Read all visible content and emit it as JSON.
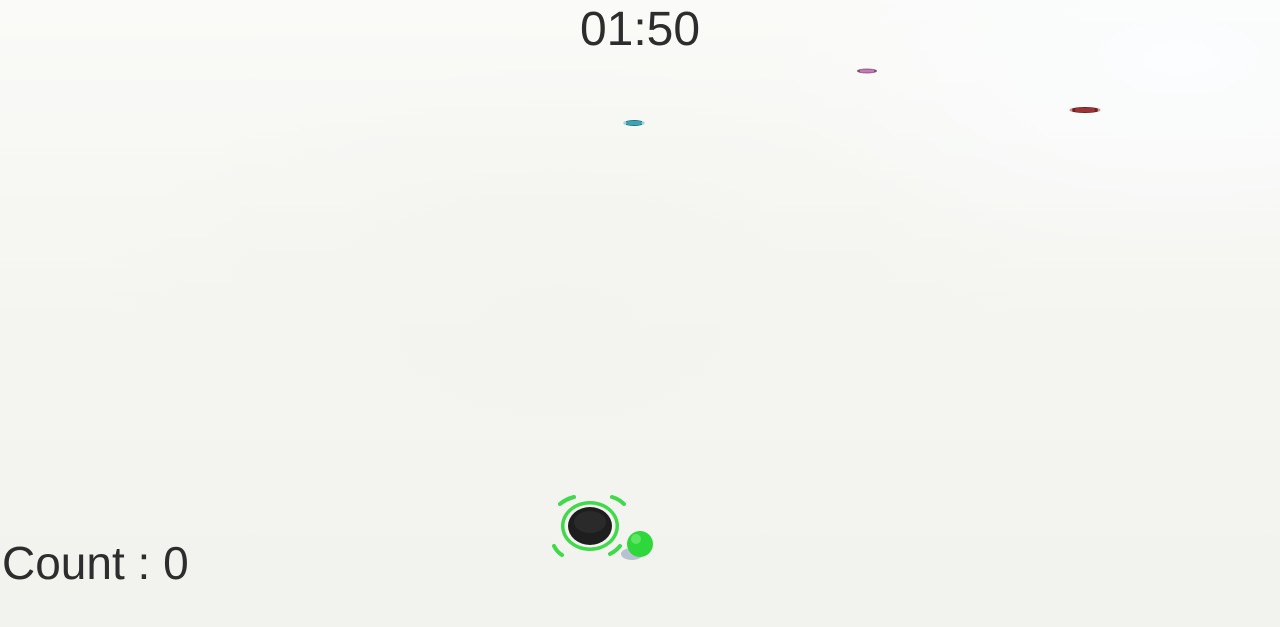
{
  "hud": {
    "timer": "01:50",
    "count_text": "Count : 0"
  },
  "colors": {
    "player_ring": "#3fd94a",
    "player_ball": "#2ed83a",
    "hole": "#1e1e1e",
    "text": "#2d2d2d"
  },
  "icons": {
    "player": "black-hole-with-green-ring",
    "collectible_a": "small-cyan-car",
    "collectible_b": "small-pink-car",
    "collectible_c": "small-red-car"
  }
}
